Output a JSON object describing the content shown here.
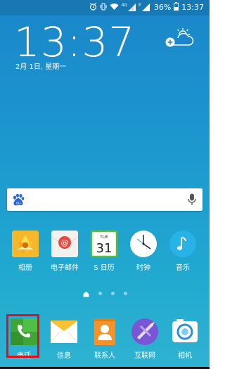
{
  "status_bar": {
    "network_label": "4G",
    "network_label_2": "E",
    "battery": "36%",
    "time": "13:37"
  },
  "lockclock": {
    "time": "13:37",
    "date": "2月 1日, 星期一"
  },
  "search_bar": {
    "logo": "baidu-paw-icon",
    "mic": "mic-icon"
  },
  "apps_row1": [
    {
      "label": "相册",
      "icon": "gallery-icon"
    },
    {
      "label": "电子邮件",
      "icon": "email-icon"
    },
    {
      "label": "S 日历",
      "icon": "calendar-icon",
      "calendar_weekday": "TUE",
      "calendar_day": "31"
    },
    {
      "label": "时钟",
      "icon": "clock-icon"
    },
    {
      "label": "音乐",
      "icon": "music-icon"
    }
  ],
  "dock": [
    {
      "label": "电话",
      "icon": "phone-icon"
    },
    {
      "label": "信息",
      "icon": "message-icon"
    },
    {
      "label": "联系人",
      "icon": "contacts-icon"
    },
    {
      "label": "互联网",
      "icon": "internet-icon"
    },
    {
      "label": "相机",
      "icon": "camera-icon"
    }
  ],
  "page_indicator": {
    "pages": 4,
    "current": 0
  },
  "colors": {
    "highlight": "#e10f1d",
    "background_top": "#1a86c9",
    "background_bottom": "#2fb3d2"
  }
}
